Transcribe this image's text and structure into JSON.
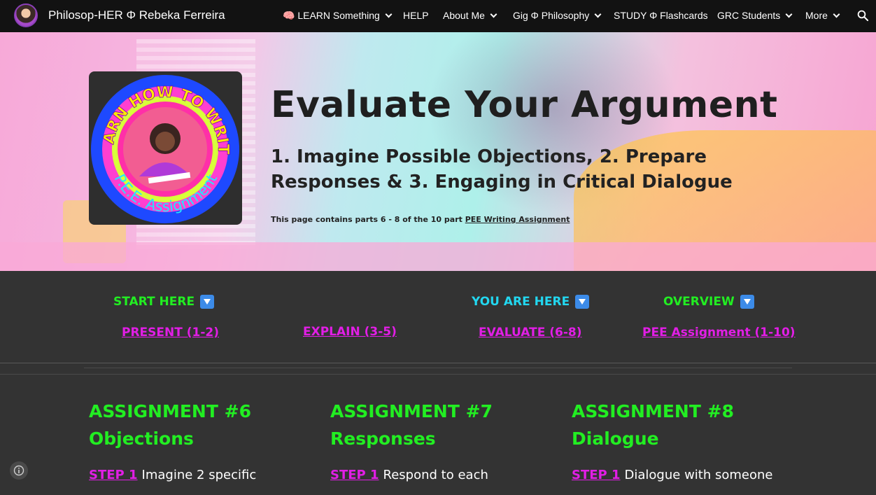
{
  "header": {
    "site_title": "Philosop-HER Φ Rebeka Ferreira",
    "nav": [
      {
        "label": "🧠 LEARN Something",
        "has_dropdown": true
      },
      {
        "label": "HELP",
        "has_dropdown": false
      },
      {
        "label": "About Me",
        "has_dropdown": true
      },
      {
        "label": "Gig Φ Philosophy",
        "has_dropdown": true
      },
      {
        "label": "STUDY Φ Flashcards",
        "has_dropdown": false
      },
      {
        "label": "GRC Students",
        "has_dropdown": true
      },
      {
        "label": "More",
        "has_dropdown": true
      }
    ],
    "search_icon": "search-icon"
  },
  "hero": {
    "logo": {
      "top_text": "LEARN HOW TO WRITE",
      "bottom_text": "P.E.E. Assignment"
    },
    "title": "Evaluate Your Argument",
    "subtitle": "1. Imagine Possible Objections, 2. Prepare Responses & 3. Engaging in Critical Dialogue",
    "note_prefix": "This page contains parts 6 - 8 of the 10 part ",
    "note_link": "PEE Writing Assignment"
  },
  "section_nav": {
    "labels": [
      {
        "text": "START HERE",
        "color": "#22ee22"
      },
      {
        "text": "YOU ARE HERE",
        "color": "#22d7f0"
      },
      {
        "text": "OVERVIEW",
        "color": "#22ee22"
      }
    ],
    "links": [
      "PRESENT (1-2)",
      "EXPLAIN (3-5)",
      "EVALUATE (6-8)",
      "PEE Assignment (1-10)"
    ]
  },
  "assignments": [
    {
      "title_line1": "ASSIGNMENT #6",
      "title_line2": "Objections",
      "step_label": "STEP 1",
      "step_text": "Imagine 2 specific"
    },
    {
      "title_line1": "ASSIGNMENT #7",
      "title_line2": "Responses",
      "step_label": "STEP 1",
      "step_text": "Respond to each"
    },
    {
      "title_line1": "ASSIGNMENT #8",
      "title_line2": "Dialogue",
      "step_label": "STEP 1",
      "step_text": "Dialogue with someone"
    }
  ],
  "colors": {
    "accent_green": "#22ee22",
    "accent_magenta": "#e21ee6",
    "accent_cyan": "#22d7f0",
    "topbar": "#121212",
    "body_bg": "#333333"
  }
}
